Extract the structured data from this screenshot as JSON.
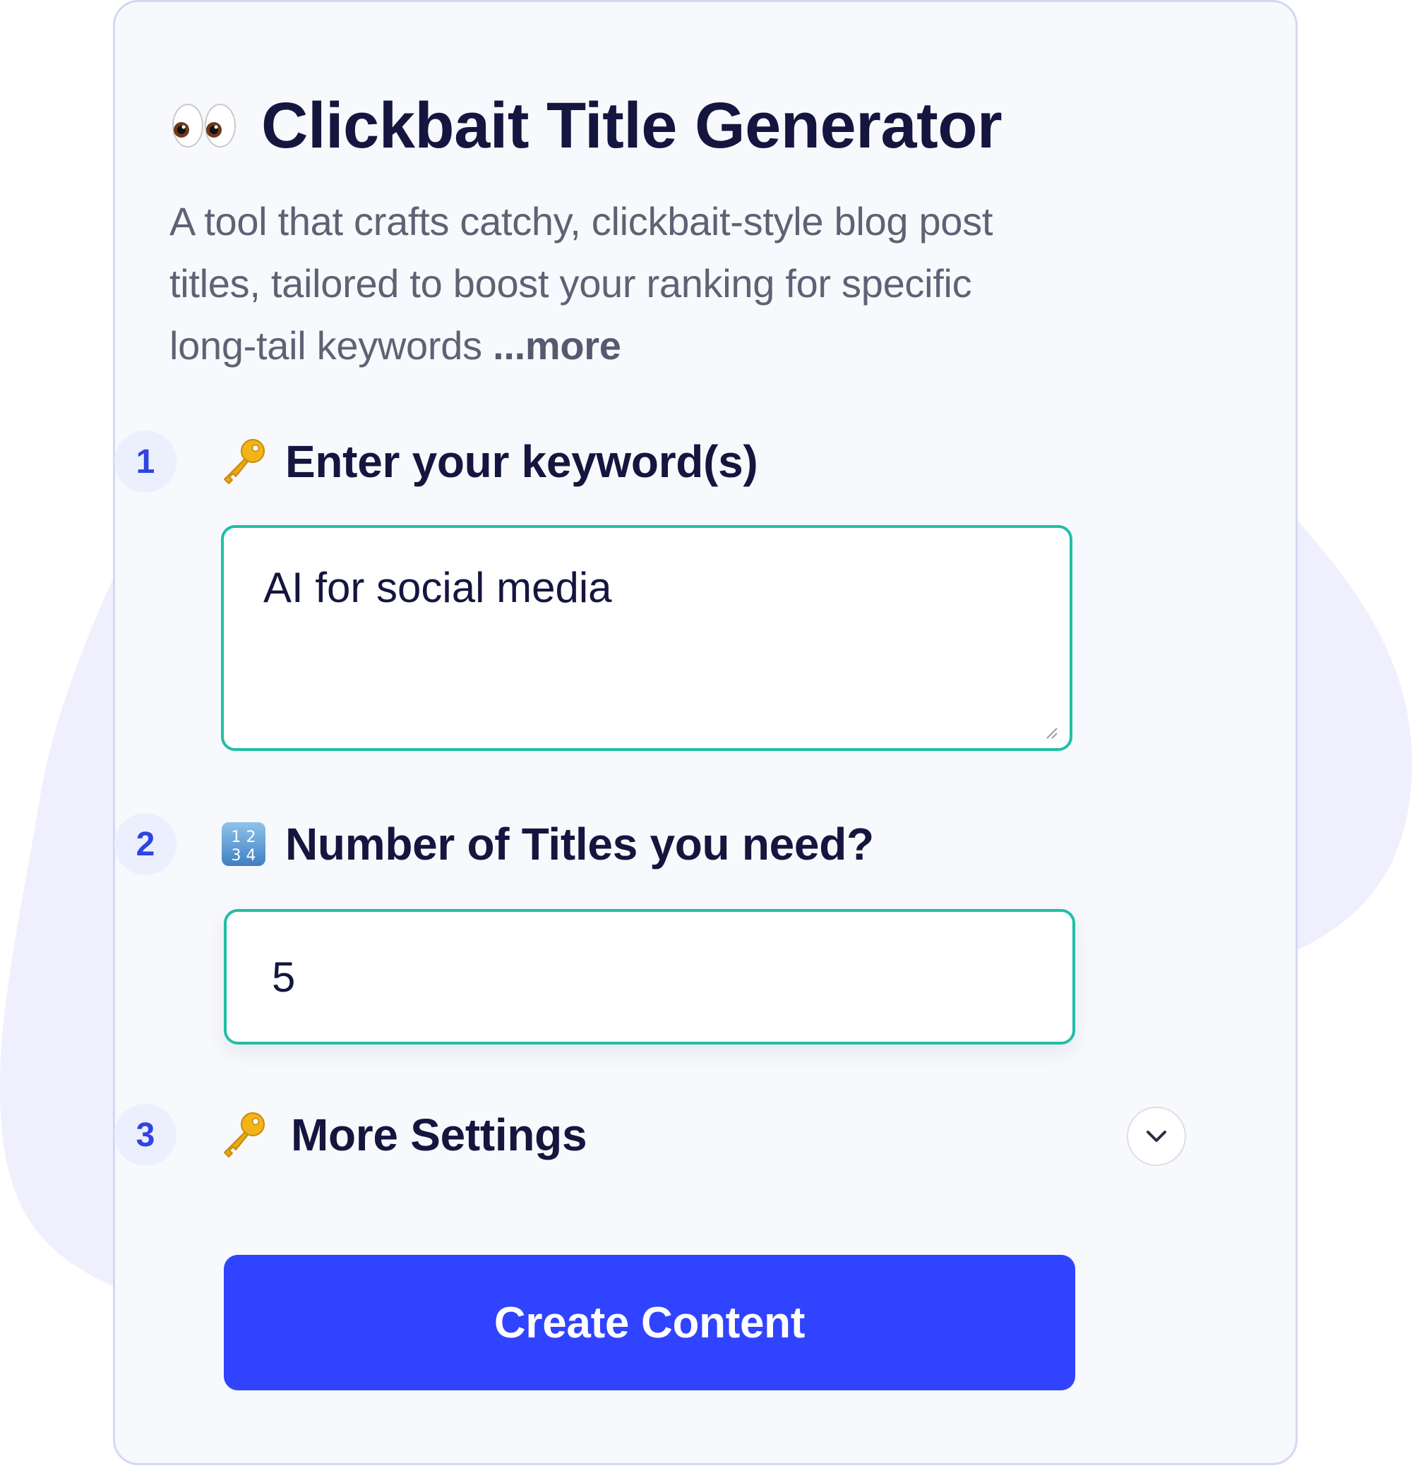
{
  "app": {
    "title": "Clickbait Title Generator",
    "title_icon": "eyes-icon",
    "description": "A tool that crafts catchy, clickbait-style blog post titles, tailored to boost your ranking for specific long-tail keywords ",
    "more_link": "...more"
  },
  "steps": [
    {
      "number": "1",
      "icon": "key-icon",
      "label": "Enter your keyword(s)",
      "field_value": "AI for social media"
    },
    {
      "number": "2",
      "icon": "input-numbers-icon",
      "label": "Number of Titles you need?",
      "field_value": "5"
    },
    {
      "number": "3",
      "icon": "key-icon",
      "label": "More Settings",
      "toggle_icon": "chevron-down-icon"
    }
  ],
  "submit": {
    "label": "Create Content"
  },
  "colors": {
    "accent": "#3043ff",
    "field_border": "#1fbfa6",
    "heading": "#15163f",
    "badge_bg": "#eceffd",
    "badge_text": "#2f44e0",
    "blob": "#efeffd",
    "card_bg": "#f8f9fc",
    "card_border": "#d3d8f4"
  }
}
